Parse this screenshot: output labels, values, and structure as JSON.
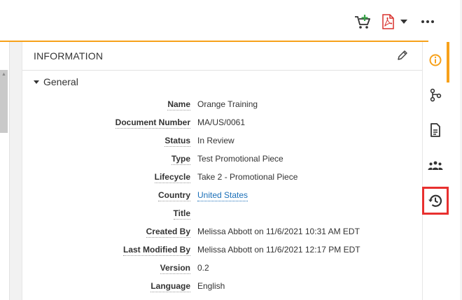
{
  "toolbar": {
    "icons": [
      "add-to-cart-icon",
      "pdf-icon",
      "chevron-down-icon",
      "more-options-icon"
    ]
  },
  "panel": {
    "title": "INFORMATION",
    "section_label": "General",
    "fields": [
      {
        "label": "Name",
        "value": "Orange Training"
      },
      {
        "label": "Document Number",
        "value": "MA/US/0061"
      },
      {
        "label": "Status",
        "value": "In Review"
      },
      {
        "label": "Type",
        "value": "Test Promotional Piece"
      },
      {
        "label": "Lifecycle",
        "value": "Take 2 - Promotional Piece"
      },
      {
        "label": "Country",
        "value": "United States"
      },
      {
        "label": "Title",
        "value": ""
      },
      {
        "label": "Created By",
        "value": "Melissa Abbott on 11/6/2021 10:31 AM EDT"
      },
      {
        "label": "Last Modified By",
        "value": "Melissa Abbott on 11/6/2021 12:17 PM EDT"
      },
      {
        "label": "Version",
        "value": "0.2"
      },
      {
        "label": "Language",
        "value": "English"
      }
    ]
  },
  "sidebar": {
    "items": [
      "info-icon",
      "workflow-icon",
      "document-icon",
      "users-icon",
      "history-icon"
    ],
    "active": "info-icon",
    "highlighted": "history-icon"
  },
  "colors": {
    "accent": "#f7a11a",
    "link": "#1a6fb8",
    "highlight": "#e8302f",
    "cart_green": "#3aa34a",
    "pdf_red": "#d9302c"
  }
}
